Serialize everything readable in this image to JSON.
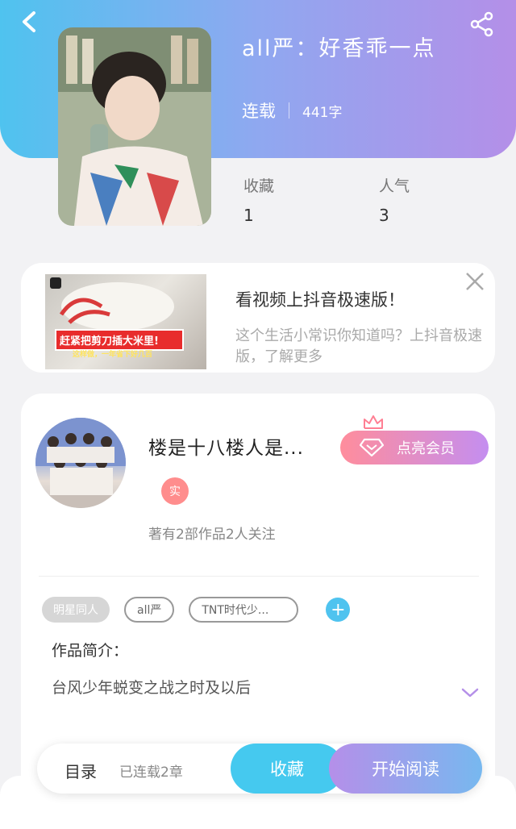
{
  "header": {
    "title": "all严：好香乖一点",
    "status": "连载",
    "word_count": "441字",
    "stats": [
      {
        "label": "收藏",
        "value": "1"
      },
      {
        "label": "人气",
        "value": "3"
      }
    ]
  },
  "ad": {
    "title": "看视频上抖音极速版！",
    "description": "这个生活小常识你知道吗？上抖音极速版，了解更多",
    "image_banner": "赶紧把剪刀插大米里!",
    "image_sub": "这样做，一年省下好几百"
  },
  "author": {
    "name": "楼是十八楼人是...",
    "vip_label": "点亮会员",
    "real_badge": "实",
    "works_info": "著有2部作品2人关注"
  },
  "tags": [
    "明星同人",
    "all严",
    "TNT时代少..."
  ],
  "intro": {
    "label": "作品简介：",
    "text": "台风少年蜕变之战之时及以后"
  },
  "bottom_bar": {
    "toc": "目录",
    "chapters": "已连载2章",
    "favorite": "收藏",
    "read": "开始阅读"
  },
  "colors": {
    "header_start": "#4fc3ef",
    "header_end": "#b48fe8",
    "accent_blue": "#45c9ef",
    "vip_pink": "#ff8d9c"
  }
}
